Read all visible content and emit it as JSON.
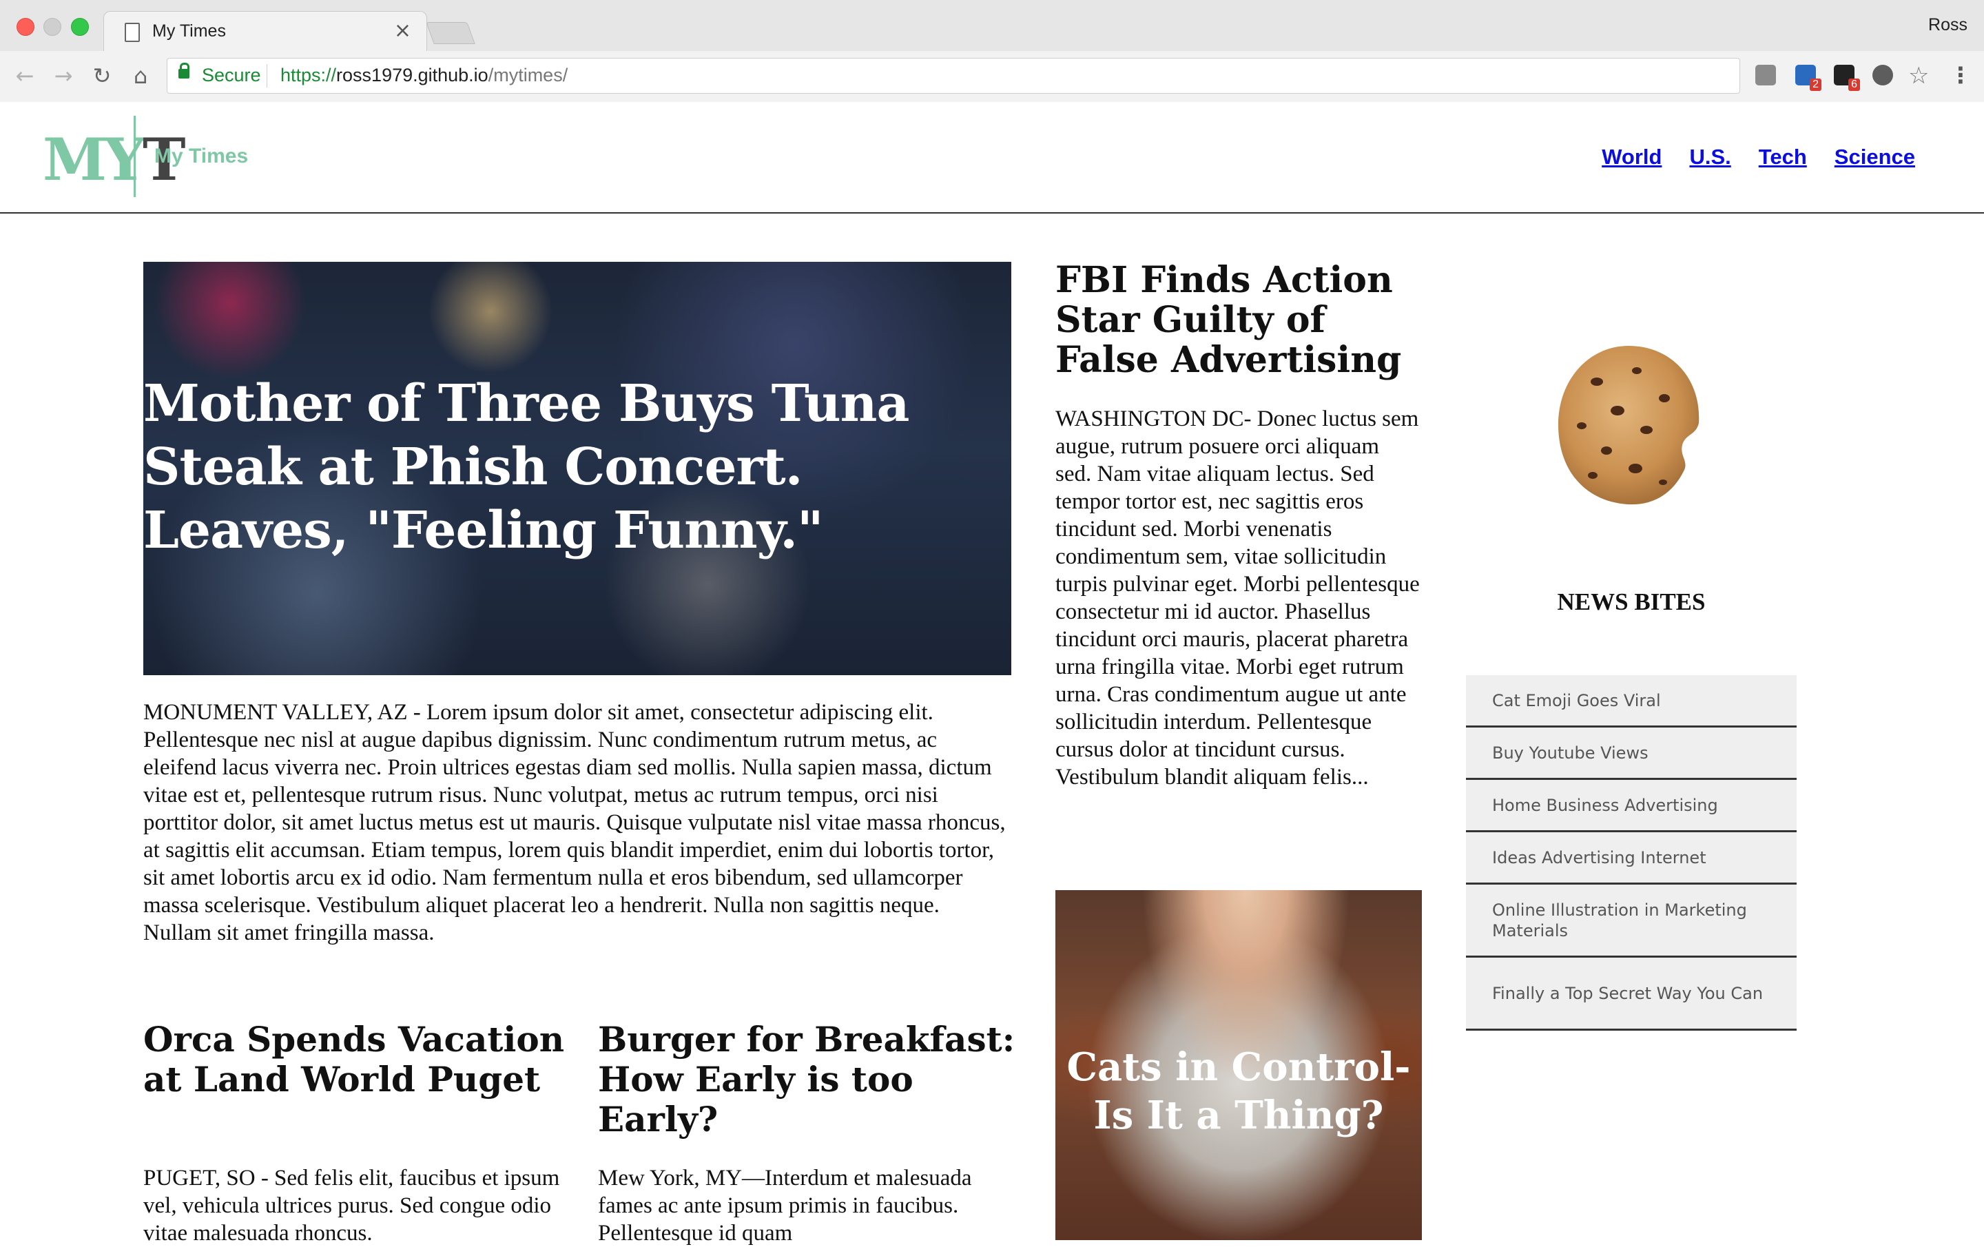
{
  "browser": {
    "tab_title": "My Times",
    "tab_close": "×",
    "profile_name": "Ross",
    "secure_label": "Secure",
    "url_scheme": "https://",
    "url_host": "ross1979.github.io",
    "url_path": "/mytimes/",
    "extensions": [
      {
        "name": "pocket-icon"
      },
      {
        "name": "linkedin-icon",
        "badge": "2"
      },
      {
        "name": "calendar-icon",
        "badge": "6"
      },
      {
        "name": "lightbulb-icon"
      }
    ]
  },
  "site": {
    "logo_text_a": "MY",
    "logo_text_b": "T",
    "name": "My Times",
    "nav": [
      "World",
      "U.S.",
      "Tech",
      "Science"
    ],
    "colors": {
      "accent": "#7ec8a6",
      "link": "#0b0ee0"
    }
  },
  "lead": {
    "headline": "Mother of Three Buys Tuna Steak at Phish Concert. Leaves, \"Feeling Funny.\"",
    "body": "MONUMENT VALLEY, AZ - Lorem ipsum dolor sit amet, consectetur adipiscing elit. Pellentesque nec nisl at augue dapibus dignissim. Nunc condimentum rutrum metus, ac eleifend lacus viverra nec. Proin ultrices egestas diam sed mollis. Nulla sapien massa, dictum vitae est et, pellentesque rutrum risus. Nunc volutpat, metus ac rutrum tempus, orci nisi porttitor dolor, sit amet luctus metus est ut mauris. Quisque vulputate nisl vitae massa rhoncus, at sagittis elit accumsan. Etiam tempus, lorem quis blandit imperdiet, enim dui lobortis tortor, sit amet lobortis arcu ex id odio. Nam fermentum nulla et eros bibendum, sed ullamcorper massa scelerisque. Vestibulum aliquet placerat leo a hendrerit. Nulla non sagittis neque. Nullam sit amet fringilla massa."
  },
  "orca": {
    "headline": "Orca Spends Vacation at Land World Puget",
    "body": "PUGET, SO - Sed felis elit, faucibus et ipsum vel, vehicula ultrices purus. Sed congue odio vitae malesuada rhoncus."
  },
  "burger": {
    "headline": "Burger for Breakfast: How Early is too Early?",
    "body": "Mew York, MY—Interdum et malesuada fames ac ante ipsum primis in faucibus. Pellentesque id quam"
  },
  "fbi": {
    "headline": "FBI Finds Action Star Guilty of False Advertising",
    "body": "WASHINGTON DC- Donec luctus sem augue, rutrum posuere orci aliquam sed. Nam vitae aliquam lectus. Sed tempor tortor est, nec sagittis eros tincidunt sed. Morbi venenatis condimentum sem, vitae sollicitudin turpis pulvinar eget. Morbi pellentesque consectetur mi id auctor. Phasellus tincidunt orci mauris, placerat pharetra urna fringilla vitae. Morbi eget rutrum urna. Cras condimentum augue ut ante sollicitudin interdum. Pellentesque cursus dolor at tincidunt cursus. Vestibulum blandit aliquam felis..."
  },
  "cats": {
    "headline": "Cats in Control- Is It a Thing?"
  },
  "news_bites": {
    "title": "NEWS BITES",
    "items": [
      "Cat Emoji Goes Viral",
      "Buy Youtube Views",
      "Home Business Advertising",
      "Ideas Advertising Internet",
      "Online Illustration in Marketing Materials",
      "Finally a Top Secret Way You Can"
    ]
  }
}
